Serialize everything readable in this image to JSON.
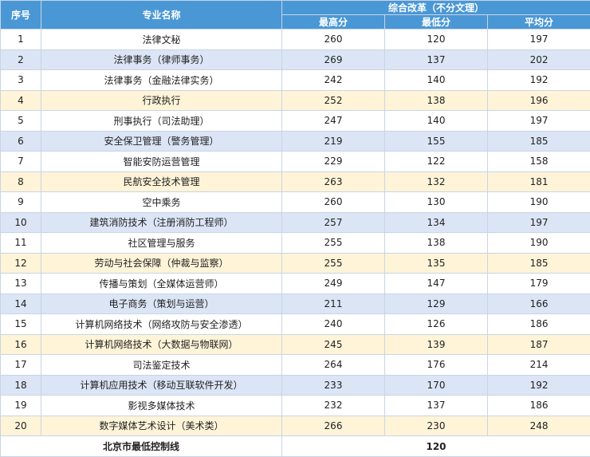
{
  "headers": {
    "seq": "序号",
    "major": "专业名称",
    "group": "综合改革（不分文理）",
    "max": "最高分",
    "min": "最低分",
    "avg": "平均分"
  },
  "rows": [
    {
      "seq": "1",
      "name": "法律文秘",
      "max": "260",
      "min": "120",
      "avg": "197"
    },
    {
      "seq": "2",
      "name": "法律事务（律师事务）",
      "max": "269",
      "min": "137",
      "avg": "202"
    },
    {
      "seq": "3",
      "name": "法律事务（金融法律实务）",
      "max": "242",
      "min": "140",
      "avg": "192"
    },
    {
      "seq": "4",
      "name": "行政执行",
      "max": "252",
      "min": "138",
      "avg": "196"
    },
    {
      "seq": "5",
      "name": "刑事执行（司法助理）",
      "max": "247",
      "min": "140",
      "avg": "197"
    },
    {
      "seq": "6",
      "name": "安全保卫管理（警务管理）",
      "max": "219",
      "min": "155",
      "avg": "185"
    },
    {
      "seq": "7",
      "name": "智能安防运营管理",
      "max": "229",
      "min": "122",
      "avg": "158"
    },
    {
      "seq": "8",
      "name": "民航安全技术管理",
      "max": "263",
      "min": "132",
      "avg": "181"
    },
    {
      "seq": "9",
      "name": "空中乘务",
      "max": "260",
      "min": "130",
      "avg": "190"
    },
    {
      "seq": "10",
      "name": "建筑消防技术（注册消防工程师）",
      "max": "257",
      "min": "134",
      "avg": "197"
    },
    {
      "seq": "11",
      "name": "社区管理与服务",
      "max": "255",
      "min": "138",
      "avg": "190"
    },
    {
      "seq": "12",
      "name": "劳动与社会保障（仲裁与监察）",
      "max": "255",
      "min": "135",
      "avg": "185"
    },
    {
      "seq": "13",
      "name": "传播与策划（全媒体运营师）",
      "max": "249",
      "min": "147",
      "avg": "179"
    },
    {
      "seq": "14",
      "name": "电子商务（策划与运营）",
      "max": "211",
      "min": "129",
      "avg": "166"
    },
    {
      "seq": "15",
      "name": "计算机网络技术（网络攻防与安全渗透）",
      "max": "240",
      "min": "126",
      "avg": "186"
    },
    {
      "seq": "16",
      "name": "计算机网络技术（大数据与物联网）",
      "max": "245",
      "min": "139",
      "avg": "187"
    },
    {
      "seq": "17",
      "name": "司法鉴定技术",
      "max": "264",
      "min": "176",
      "avg": "214"
    },
    {
      "seq": "18",
      "name": "计算机应用技术（移动互联软件开发）",
      "max": "233",
      "min": "170",
      "avg": "192"
    },
    {
      "seq": "19",
      "name": "影视多媒体技术",
      "max": "232",
      "min": "137",
      "avg": "186"
    },
    {
      "seq": "20",
      "name": "数字媒体艺术设计（美术类）",
      "max": "266",
      "min": "230",
      "avg": "248"
    }
  ],
  "footer": {
    "label": "北京市最低控制线",
    "value": "120"
  },
  "colors": {
    "header_bg": "#4a97d6",
    "row_blue": "#dbe5f5",
    "row_yellow": "#fff4d8"
  }
}
